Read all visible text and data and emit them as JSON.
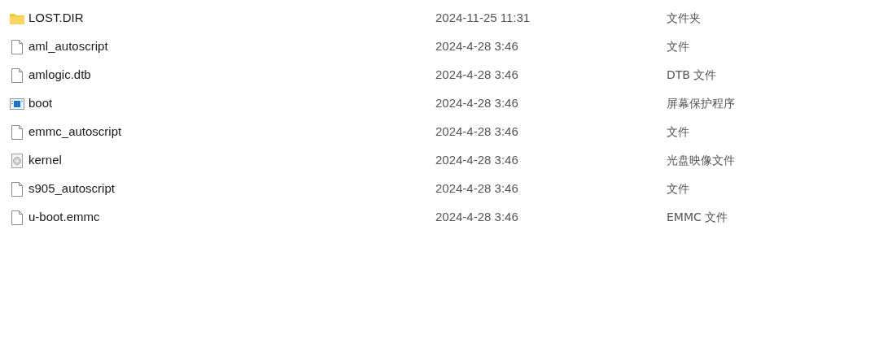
{
  "rows": [
    {
      "kind": "folder",
      "name": "LOST.DIR",
      "date": "2024-11-25 11:31",
      "type": "文件夹"
    },
    {
      "kind": "file",
      "name": "aml_autoscript",
      "date": "2024-4-28 3:46",
      "type": "文件"
    },
    {
      "kind": "file",
      "name": "amlogic.dtb",
      "date": "2024-4-28 3:46",
      "type": "DTB 文件"
    },
    {
      "kind": "screensaver",
      "name": "boot",
      "date": "2024-4-28 3:46",
      "type": "屏幕保护程序"
    },
    {
      "kind": "file",
      "name": "emmc_autoscript",
      "date": "2024-4-28 3:46",
      "type": "文件"
    },
    {
      "kind": "disc",
      "name": "kernel",
      "date": "2024-4-28 3:46",
      "type": "光盘映像文件"
    },
    {
      "kind": "file",
      "name": "s905_autoscript",
      "date": "2024-4-28 3:46",
      "type": "文件"
    },
    {
      "kind": "file",
      "name": "u-boot.emmc",
      "date": "2024-4-28 3:46",
      "type": "EMMC 文件"
    }
  ]
}
